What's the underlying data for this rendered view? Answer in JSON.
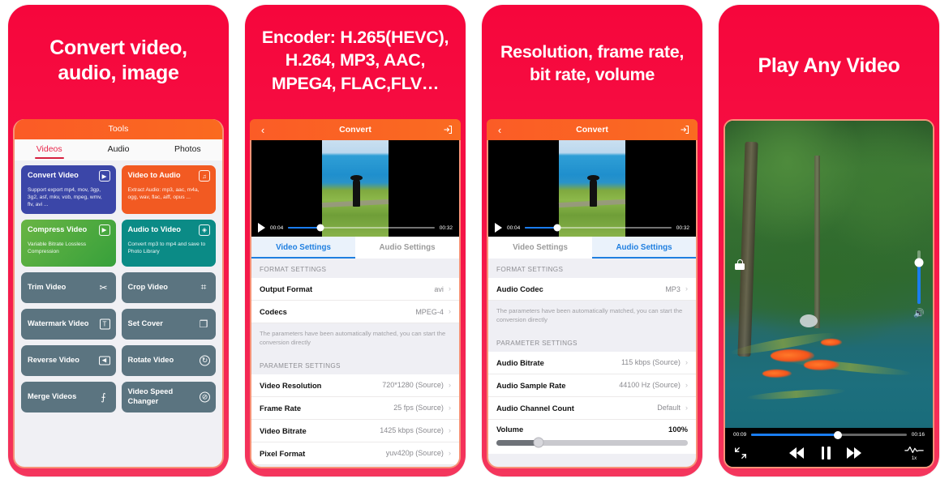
{
  "theme": {
    "brand_red": "#f5123f",
    "orange_navbar": "#fb5c26",
    "accent_blue": "#1f7fe0",
    "phone_border": "#f79277"
  },
  "panels": [
    {
      "id": "tools",
      "headline": "Convert video,\naudio, image",
      "headline_line1": "Convert video,",
      "headline_line2": "audio, image",
      "navbar_title": "Tools",
      "tabs": [
        {
          "label": "Videos",
          "active": true
        },
        {
          "label": "Audio",
          "active": false
        },
        {
          "label": "Photos",
          "active": false
        }
      ],
      "tiles": [
        {
          "title": "Convert Video",
          "subtitle": "Support export mp4, mov, 3gp, 3g2, asf, mkv, vob, mpeg, wmv, flv, avi ...",
          "icon": "play-box-icon",
          "glyph": "▶",
          "color": "#3b46a8",
          "big": true
        },
        {
          "title": "Video to Audio",
          "subtitle": "Extract Audio: mp3, aac, m4a, ogg, wav, flac, aiff, opus ...",
          "icon": "music-note-icon",
          "glyph": "♫",
          "color": "#f25a22",
          "big": true
        },
        {
          "title": "Compress Video",
          "subtitle": "Variable Bitrate Lossless Compression",
          "icon": "compress-icon",
          "glyph": "▶",
          "color": "#45a83f",
          "big": true
        },
        {
          "title": "Audio to Video",
          "subtitle": "Convert mp3 to mp4 and save to Photo Library",
          "icon": "audio-wave-icon",
          "glyph": "◈",
          "color": "#0b8b86",
          "big": true
        },
        {
          "title": "Trim Video",
          "subtitle": "",
          "icon": "scissors-icon",
          "glyph": "✂",
          "color": "#5b7480",
          "big": false
        },
        {
          "title": "Crop Video",
          "subtitle": "",
          "icon": "crop-icon",
          "glyph": "⌗",
          "color": "#5b7480",
          "big": false
        },
        {
          "title": "Watermark Video",
          "subtitle": "",
          "icon": "text-watermark-icon",
          "glyph": "T",
          "color": "#5b7480",
          "big": false
        },
        {
          "title": "Set Cover",
          "subtitle": "",
          "icon": "bookmark-icon",
          "glyph": "❐",
          "color": "#5b7480",
          "big": false
        },
        {
          "title": "Reverse Video",
          "subtitle": "",
          "icon": "reverse-icon",
          "glyph": "◀",
          "color": "#5b7480",
          "big": false
        },
        {
          "title": "Rotate Video",
          "subtitle": "",
          "icon": "rotate-icon",
          "glyph": "↻",
          "color": "#5b7480",
          "big": false
        },
        {
          "title": "Merge Videos",
          "subtitle": "",
          "icon": "merge-icon",
          "glyph": "⨍",
          "color": "#5b7480",
          "big": false
        },
        {
          "title": "Video Speed Changer",
          "subtitle": "",
          "icon": "speedometer-icon",
          "glyph": "⊘",
          "color": "#5b7480",
          "big": false
        }
      ]
    },
    {
      "id": "video-settings",
      "headline_line1": "Encoder: H.265(HEVC),",
      "headline_line2": "H.264, MP3, AAC,",
      "headline_line3": "MPEG4, FLAC,FLV…",
      "navbar": {
        "back_icon": "chevron-left-icon",
        "title": "Convert",
        "action_icon": "export-icon"
      },
      "player": {
        "current_time": "00:04",
        "duration": "00:32",
        "progress_pct": 22,
        "play_icon": "play-icon"
      },
      "tabs": [
        {
          "label": "Video Settings",
          "active": true
        },
        {
          "label": "Audio Settings",
          "active": false
        }
      ],
      "sections": [
        {
          "header": "FORMAT SETTINGS",
          "rows": [
            {
              "label": "Output Format",
              "value": "avi"
            },
            {
              "label": "Codecs",
              "value": "MPEG-4"
            }
          ],
          "note": "The parameters have been automatically matched, you can start the conversion directly"
        },
        {
          "header": "PARAMETER SETTINGS",
          "rows": [
            {
              "label": "Video Resolution",
              "value": "720*1280 (Source)"
            },
            {
              "label": "Frame Rate",
              "value": "25 fps (Source)"
            },
            {
              "label": "Video Bitrate",
              "value": "1425 kbps (Source)"
            },
            {
              "label": "Pixel Format",
              "value": "yuv420p (Source)"
            }
          ],
          "note": ""
        }
      ]
    },
    {
      "id": "audio-settings",
      "headline_line1": "Resolution, frame rate,",
      "headline_line2": "bit rate, volume",
      "navbar": {
        "back_icon": "chevron-left-icon",
        "title": "Convert",
        "action_icon": "export-icon"
      },
      "player": {
        "current_time": "00:04",
        "duration": "00:32",
        "progress_pct": 22,
        "play_icon": "play-icon"
      },
      "tabs": [
        {
          "label": "Video Settings",
          "active": false
        },
        {
          "label": "Audio Settings",
          "active": true
        }
      ],
      "sections": [
        {
          "header": "FORMAT SETTINGS",
          "rows": [
            {
              "label": "Audio Codec",
              "value": "MP3"
            }
          ],
          "note": "The parameters have been automatically matched, you can start the conversion directly"
        },
        {
          "header": "PARAMETER SETTINGS",
          "rows": [
            {
              "label": "Audio Bitrate",
              "value": "115 kbps (Source)"
            },
            {
              "label": "Audio Sample Rate",
              "value": "44100 Hz (Source)"
            },
            {
              "label": "Audio Channel Count",
              "value": "Default"
            }
          ],
          "note": ""
        }
      ],
      "volume": {
        "label": "Volume",
        "value": "100%",
        "knob_pct": 22
      }
    },
    {
      "id": "player",
      "headline_line1": "Play Any Video",
      "player": {
        "current_time": "00:09",
        "duration": "00:16",
        "progress_pct": 56,
        "lock_icon": "lock-icon",
        "volume_icon": "speaker-icon",
        "expand_icon": "expand-icon",
        "rewind_icon": "rewind-icon",
        "pause_icon": "pause-icon",
        "forward_icon": "fast-forward-icon",
        "speed_icon": "waveform-icon",
        "speed_label": "1x"
      }
    }
  ]
}
